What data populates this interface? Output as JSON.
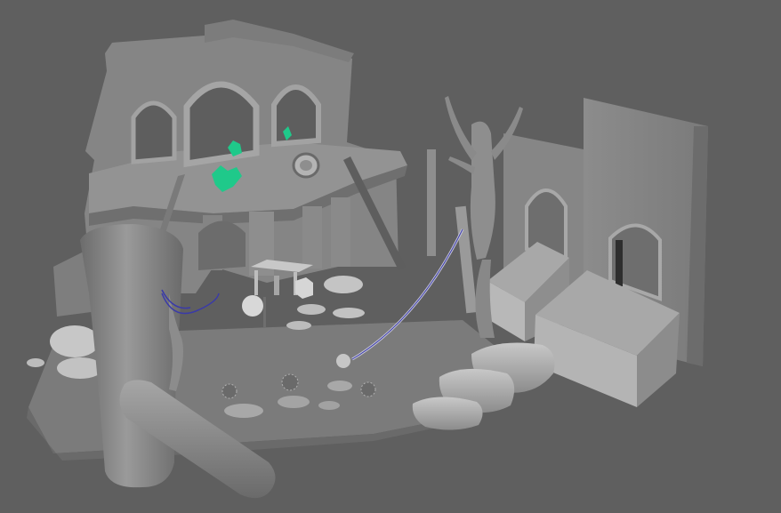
{
  "viewport": {
    "background": "#5f5f5f",
    "view": "perspective"
  },
  "scene": {
    "objects": [
      "ruined-building-facade",
      "arched-windows",
      "green-foliage",
      "round-clock",
      "wooden-beam",
      "stone-ground-platform",
      "stepping-stones",
      "small-plants",
      "bench-table",
      "small-cube",
      "lantern",
      "hanging-rope",
      "rope-weight",
      "dead-tree-left",
      "fallen-log",
      "dead-tree-right",
      "back-wall-panels",
      "stair-sets",
      "stone-steps"
    ],
    "colors": {
      "mesh": "#8a8a8a",
      "mesh_light": "#a9a9a9",
      "mesh_dark": "#6e6e6e",
      "foliage": "#1fc98a",
      "rope_blue": "#3a3aa8"
    }
  }
}
